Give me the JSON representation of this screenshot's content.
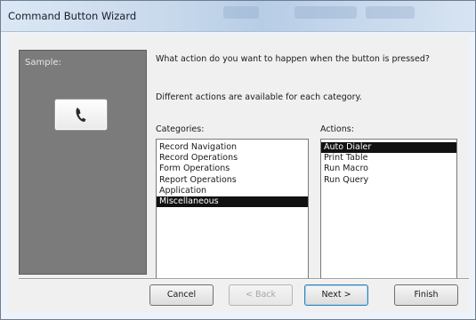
{
  "window": {
    "title": "Command Button Wizard"
  },
  "sample": {
    "label": "Sample:",
    "button_icon": "phone-icon"
  },
  "prompt": {
    "question": "What action do you want to happen when the button is pressed?",
    "hint": "Different actions are available for each category."
  },
  "categories": {
    "label": "Categories:",
    "items": [
      "Record Navigation",
      "Record Operations",
      "Form Operations",
      "Report Operations",
      "Application",
      "Miscellaneous"
    ],
    "selected": "Miscellaneous"
  },
  "actions": {
    "label": "Actions:",
    "items": [
      "Auto Dialer",
      "Print Table",
      "Run Macro",
      "Run Query"
    ],
    "selected": "Auto Dialer"
  },
  "buttons": {
    "cancel": "Cancel",
    "back": "< Back",
    "next": "Next >",
    "finish": "Finish"
  },
  "colors": {
    "selection": "#111111",
    "sample_panel": "#7b7b7b"
  }
}
